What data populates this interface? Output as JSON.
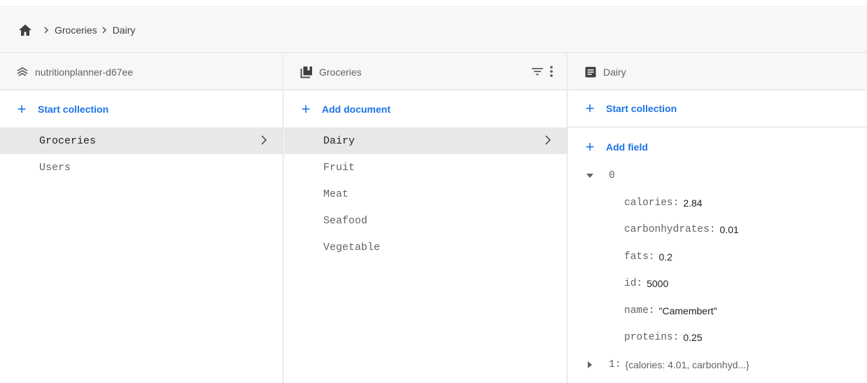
{
  "breadcrumb": {
    "home_icon": "home-icon",
    "items": [
      "Groceries",
      "Dairy"
    ]
  },
  "panels": {
    "root": {
      "title": "nutritionplanner-d67ee",
      "icon": "database-stack-icon",
      "action_label": "Start collection",
      "items": [
        "Groceries",
        "Users"
      ],
      "selected": "Groceries"
    },
    "collection": {
      "title": "Groceries",
      "icon": "collection-icon",
      "action_label": "Add document",
      "items": [
        "Dairy",
        "Fruit",
        "Meat",
        "Seafood",
        "Vegetable"
      ],
      "selected": "Dairy"
    },
    "document": {
      "title": "Dairy",
      "icon": "document-icon",
      "start_collection_label": "Start collection",
      "add_field_label": "Add field",
      "expanded_key": "0",
      "fields": [
        {
          "key": "calories:",
          "value": "2.84"
        },
        {
          "key": "carbonhydrates:",
          "value": "0.01"
        },
        {
          "key": "fats:",
          "value": "0.2"
        },
        {
          "key": "id:",
          "value": "5000"
        },
        {
          "key": "name:",
          "value": "\"Camembert\""
        },
        {
          "key": "proteins:",
          "value": "0.25"
        }
      ],
      "collapsed_key": "1:",
      "collapsed_preview": "{calories: 4.01, carbonhyd...}"
    }
  },
  "colors": {
    "accent": "#1a73e8",
    "header_bg": "#f7f7f7",
    "selected_bg": "#e8e8e8",
    "divider": "#dadce0"
  }
}
